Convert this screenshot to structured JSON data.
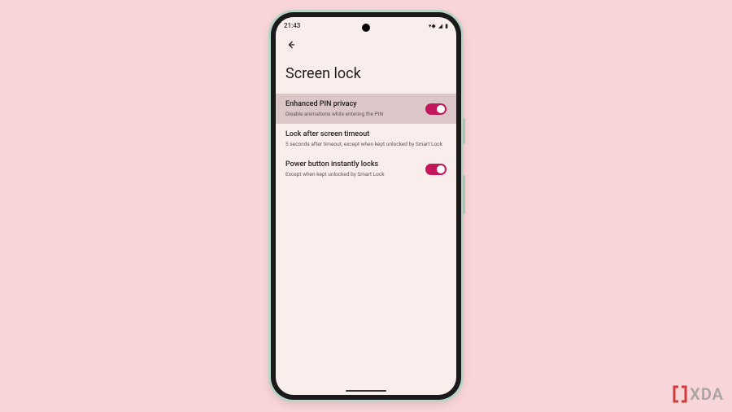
{
  "status": {
    "time": "21:43",
    "wifi_glyph": "▾◆",
    "signal_glyph": "◢",
    "battery_glyph": "▮"
  },
  "page_title": "Screen lock",
  "rows": [
    {
      "title": "Enhanced PIN privacy",
      "subtitle": "Disable animations while entering the PIN",
      "toggle": true,
      "highlighted": true
    },
    {
      "title": "Lock after screen timeout",
      "subtitle": "5 seconds after timeout, except when kept unlocked by Smart Lock",
      "toggle": null,
      "highlighted": false
    },
    {
      "title": "Power button instantly locks",
      "subtitle": "Except when kept unlocked by Smart Lock",
      "toggle": true,
      "highlighted": false
    }
  ],
  "watermark": {
    "text": "XDA"
  },
  "colors": {
    "page_bg": "#f8d5d8",
    "screen_bg": "#faeeed",
    "highlight_bg": "#dcc7c8",
    "accent": "#c2185b"
  }
}
